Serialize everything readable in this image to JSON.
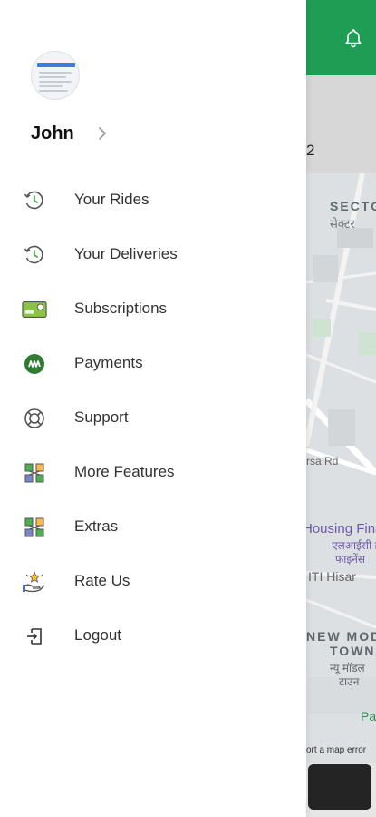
{
  "profile": {
    "name": "John"
  },
  "menu": {
    "items": [
      {
        "label": "Your Rides",
        "icon": "clock-history-icon"
      },
      {
        "label": "Your Deliveries",
        "icon": "clock-history-icon"
      },
      {
        "label": "Subscriptions",
        "icon": "card-icon"
      },
      {
        "label": "Payments",
        "icon": "payments-icon"
      },
      {
        "label": "Support",
        "icon": "lifebuoy-icon"
      },
      {
        "label": "More Features",
        "icon": "features-grid-icon"
      },
      {
        "label": "Extras",
        "icon": "features-grid-icon"
      },
      {
        "label": "Rate Us",
        "icon": "rate-hand-icon"
      },
      {
        "label": "Logout",
        "icon": "logout-icon"
      }
    ]
  },
  "background": {
    "strip_number": "2",
    "map_labels": {
      "sector": "SECTO",
      "sector_hi": "सेक्टर",
      "sirsa_rd": "rsa Rd",
      "housing": "Housing Fina",
      "housing_hi1": "एलआईसी ह",
      "housing_hi2": "फाइनेंस ",
      "iti": "ITI Hisar",
      "new_mod": "NEW MOD",
      "town": "TOWN",
      "town_hi1": "न्यू मॉडल",
      "town_hi2": "टाउन",
      "pa": "Pa",
      "report": "ort a map error"
    }
  },
  "colors": {
    "header_green": "#1f9d55",
    "payments_green": "#2e7d32",
    "icon_green": "#4caf50"
  }
}
